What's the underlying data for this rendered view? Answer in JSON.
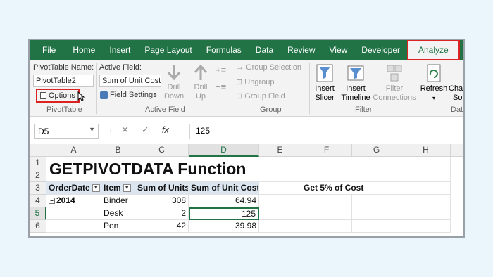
{
  "menu": {
    "tabs": [
      "File",
      "Home",
      "Insert",
      "Page Layout",
      "Formulas",
      "Data",
      "Review",
      "View",
      "Developer"
    ],
    "active_tab": "Analyze"
  },
  "ribbon": {
    "pivot_name_label": "PivotTable Name:",
    "pivot_name_value": "PivotTable2",
    "options_label": "Options",
    "pivottable_group": "PivotTable",
    "active_field_label": "Active Field:",
    "active_field_value": "Sum of Unit Cost",
    "field_settings": "Field Settings",
    "drill_down_1": "Drill",
    "drill_down_2": "Down",
    "drill_up_1": "Drill",
    "drill_up_2": "Up",
    "active_field_group": "Active Field",
    "group_selection": "Group Selection",
    "ungroup": "Ungroup",
    "group_field": "Group Field",
    "group_group": "Group",
    "insert_slicer_1": "Insert",
    "insert_slicer_2": "Slicer",
    "insert_timeline_1": "Insert",
    "insert_timeline_2": "Timeline",
    "filter_conn_1": "Filter",
    "filter_conn_2": "Connections",
    "filter_group": "Filter",
    "refresh": "Refresh",
    "change_1": "Cha",
    "change_2": "So",
    "data_group": "Data"
  },
  "formula_bar": {
    "name_box": "D5",
    "fx": "fx",
    "value": "125"
  },
  "columns": [
    "A",
    "B",
    "C",
    "D",
    "E",
    "F",
    "G",
    "H"
  ],
  "rows": [
    "1",
    "2",
    "3",
    "4",
    "5",
    "6"
  ],
  "sheet": {
    "title": "GETPIVOTDATA Function",
    "h_orderdate": "OrderDate",
    "h_item": "Item",
    "h_units": "Sum of Units",
    "h_cost": "Sum of Unit Cost",
    "get5": "Get 5% of Cost",
    "year": "2014",
    "r4_item": "Binder",
    "r4_units": "308",
    "r4_cost": "64.94",
    "r5_item": "Desk",
    "r5_units": "2",
    "r5_cost": "125",
    "r6_item": "Pen",
    "r6_units": "42",
    "r6_cost": "39.98"
  }
}
